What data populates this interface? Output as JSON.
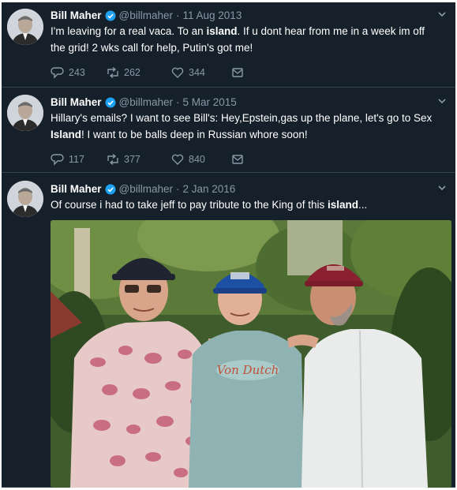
{
  "tweets": [
    {
      "author": "Bill Maher",
      "handle": "@billmaher",
      "date": "11 Aug 2013",
      "text_parts": [
        "I'm leaving for a real vaca. To an ",
        "island",
        ". If u dont hear from me in a week im off the grid! 2 wks call for help, Putin's got me!"
      ],
      "replies": "243",
      "retweets": "262",
      "likes": "344"
    },
    {
      "author": "Bill Maher",
      "handle": "@billmaher",
      "date": "5 Mar 2015",
      "text_parts": [
        "Hillary's emails? I want to see Bill's: Hey,Epstein,gas up the plane, let's go to Sex ",
        "Island",
        "! I want to be balls deep in Russian whore soon!"
      ],
      "replies": "117",
      "retweets": "377",
      "likes": "840"
    },
    {
      "author": "Bill Maher",
      "handle": "@billmaher",
      "date": "2 Jan 2016",
      "text_parts": [
        "Of course i had to take jeff to pay tribute to the King of this ",
        "island",
        "..."
      ]
    }
  ],
  "photo": {
    "shirt_text": "Von Dutch"
  },
  "icons": {
    "reply": "reply-icon",
    "retweet": "retweet-icon",
    "like": "like-icon",
    "message": "direct-message-icon",
    "verified": "verified-badge-icon",
    "caret": "chevron-down-icon"
  },
  "colors": {
    "background": "#15202b",
    "divider": "#38444d",
    "muted": "#8899a6",
    "verified": "#1da1f2",
    "text": "#ffffff"
  }
}
